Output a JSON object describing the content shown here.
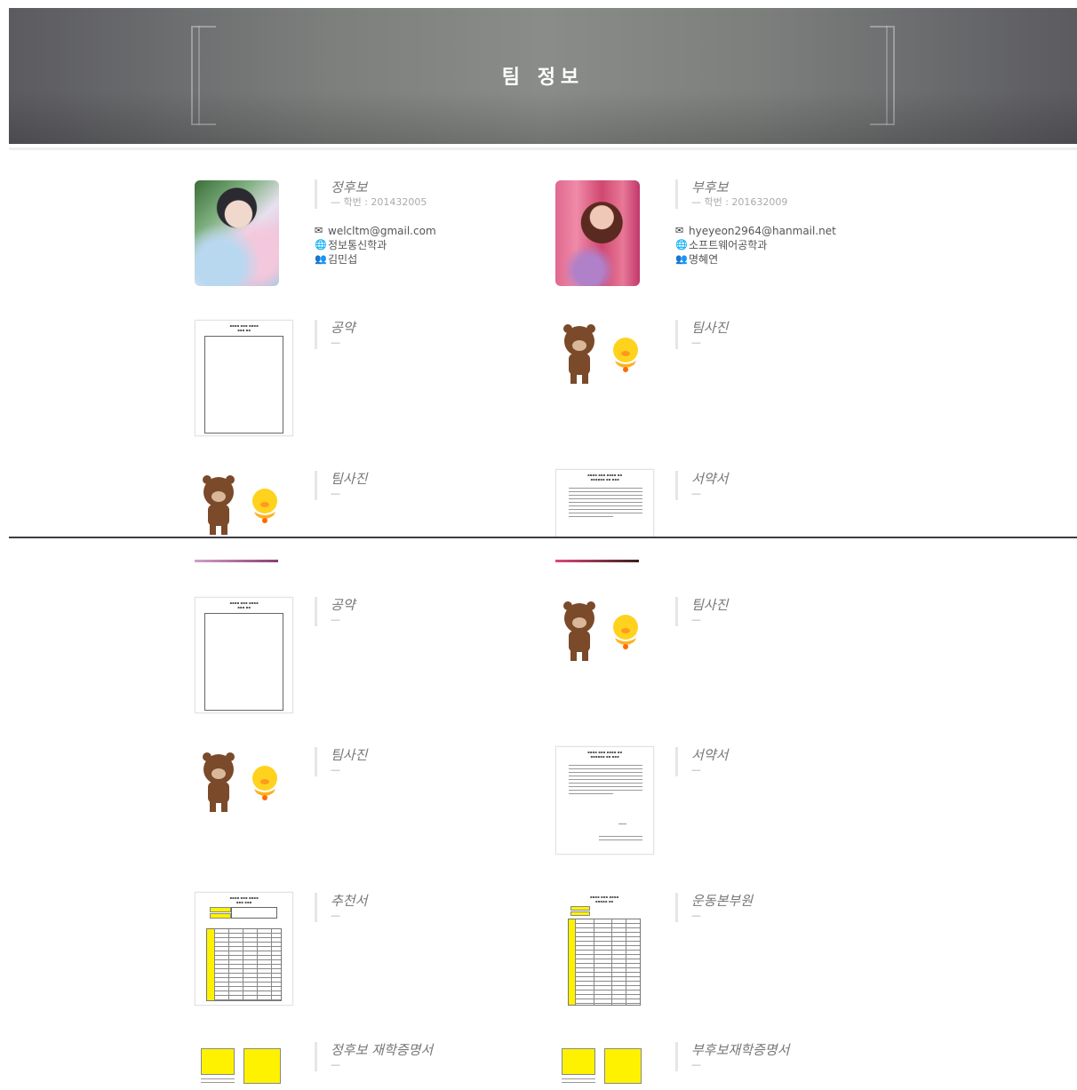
{
  "header": {
    "title": "팀 정보"
  },
  "candidates": [
    {
      "role": "정후보",
      "student_id": "— 학번 : 201432005",
      "email": "welcltm@gmail.com",
      "department": "정보통신학과",
      "name": "김민섭"
    },
    {
      "role": "부후보",
      "student_id": "— 학번 : 201632009",
      "email": "hyeyeon2964@hanmail.net",
      "department": "소프트웨어공학과",
      "name": "명혜연"
    }
  ],
  "cards": {
    "pledge": {
      "title": "공약",
      "sub": "—"
    },
    "team_photo": {
      "title": "팀사진",
      "sub": "—"
    },
    "oath": {
      "title": "서약서",
      "sub": "—"
    },
    "recommend": {
      "title": "추천서",
      "sub": "—"
    },
    "campaign": {
      "title": "운동본부원",
      "sub": "—"
    },
    "main_enroll": {
      "title": "정후보 재학증명서",
      "sub": "—"
    },
    "vice_enroll": {
      "title": "부후보재학증명서",
      "sub": "—"
    }
  },
  "icons": {
    "email": "envelope-icon",
    "department": "globe-icon",
    "name": "users-icon"
  }
}
